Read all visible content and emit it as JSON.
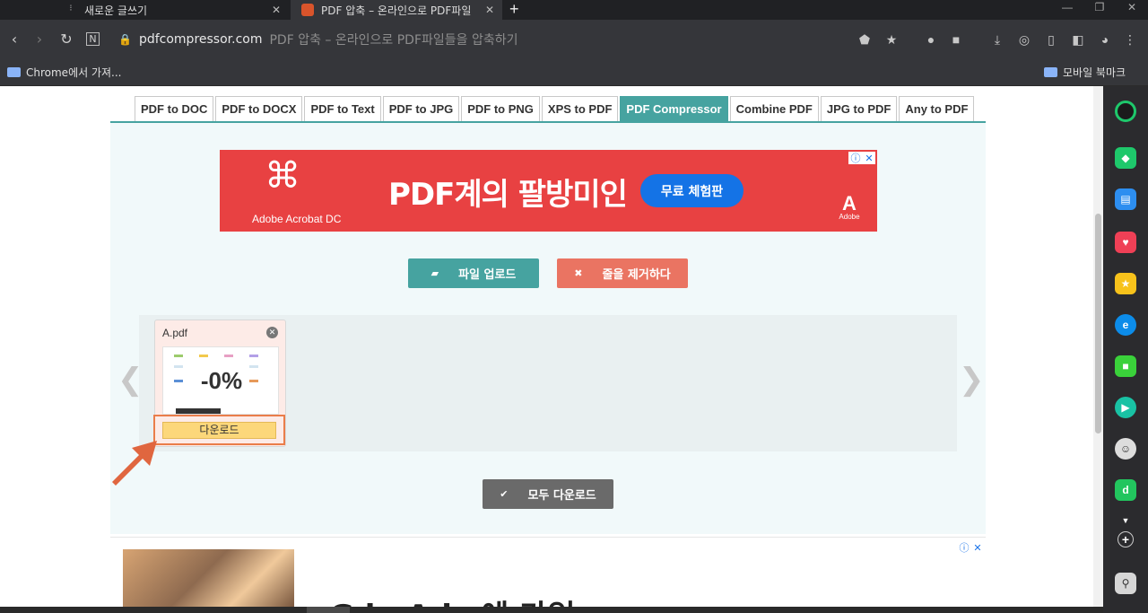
{
  "browser": {
    "tabs": [
      {
        "title": "새로운 글쓰기",
        "active": false
      },
      {
        "title": "PDF 압축 – 온라인으로 PDF파일",
        "active": true
      }
    ],
    "new_tab": "+",
    "url_host": "pdfcompressor.com",
    "page_title": "PDF 압축 – 온라인으로 PDF파일들을 압축하기",
    "bookmarks_left": "Chrome에서 가져...",
    "bookmarks_right": "모바일 북마크"
  },
  "nav_tabs": [
    "PDF to DOC",
    "PDF to DOCX",
    "PDF to Text",
    "PDF to JPG",
    "PDF to PNG",
    "XPS to PDF",
    "PDF Compressor",
    "Combine PDF",
    "JPG to PDF",
    "Any to PDF"
  ],
  "active_tab": "PDF Compressor",
  "ad_top": {
    "brand": "Adobe Acrobat DC",
    "headline": "PDF계의 팔방미인",
    "cta": "무료 체험판",
    "logo_text": "Adobe"
  },
  "actions": {
    "upload": "파일 업로드",
    "clear": "줄을 제거하다",
    "download_all": "모두 다운로드"
  },
  "file": {
    "name": "A.pdf",
    "compression": "-0%",
    "download": "다운로드"
  },
  "ad_bottom": {
    "headline": "G   le Ads 에 가입"
  },
  "colors": {
    "accent": "#46a3a0",
    "clear": "#ea7462",
    "ad_red": "#e84142",
    "download_yellow": "#fcd77a",
    "highlight_orange": "#ea7d4a"
  }
}
